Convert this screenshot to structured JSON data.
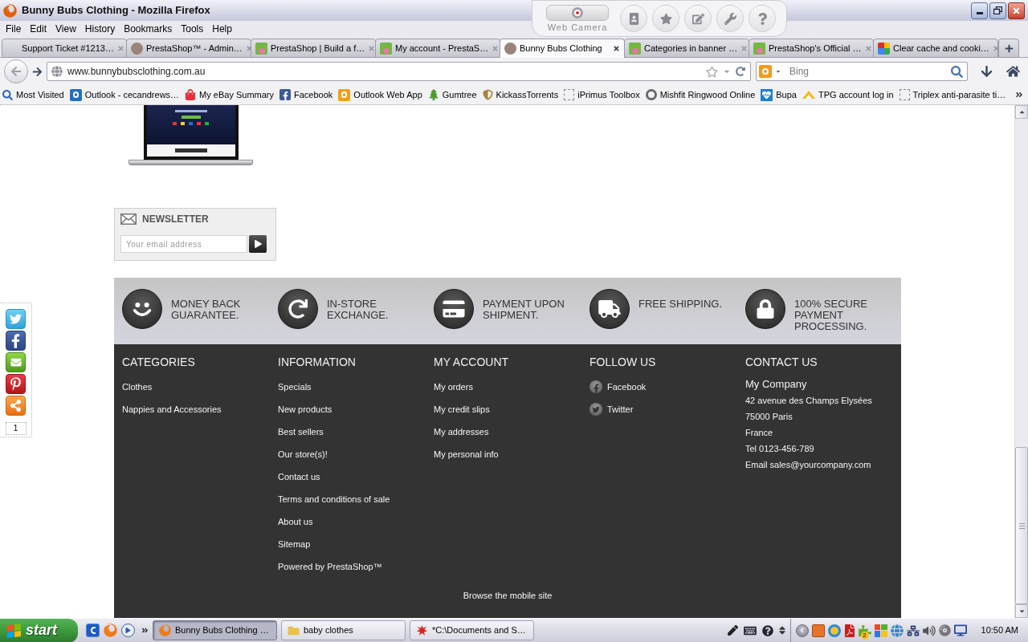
{
  "window": {
    "title": "Bunny Bubs Clothing - Mozilla Firefox"
  },
  "camera_toolbar": {
    "label": "Web Camera"
  },
  "menu": [
    "File",
    "Edit",
    "View",
    "History",
    "Bookmarks",
    "Tools",
    "Help"
  ],
  "tabs": [
    {
      "label": "Support Ticket #1213…",
      "selected": false
    },
    {
      "label": "PrestaShop™ - Admin…",
      "selected": false
    },
    {
      "label": "PrestaShop | Build a f…",
      "selected": false
    },
    {
      "label": "My account - PrestaS…",
      "selected": false
    },
    {
      "label": "Bunny Bubs Clothing",
      "selected": true
    },
    {
      "label": "Categories in banner …",
      "selected": false
    },
    {
      "label": "PrestaShop's Official …",
      "selected": false
    },
    {
      "label": "Clear cache and cooki…",
      "selected": false
    }
  ],
  "address_bar": {
    "value": "www.bunnybubsclothing.com.au"
  },
  "search": {
    "placeholder": "Bing"
  },
  "bookmarks": [
    "Most Visited",
    "Outlook - cecandrews…",
    "My eBay Summary",
    "Facebook",
    "Outlook Web App",
    "Gumtree",
    "KickassTorrents",
    "iPrimus Toolbox",
    "Mishfit Ringwood Online",
    "Bupa",
    "TPG account log in",
    "Triplex anti-parasite ti…"
  ],
  "share_sidebar": {
    "count": "1"
  },
  "newsletter": {
    "title": "NEWSLETTER",
    "placeholder": "Your email address"
  },
  "reassurance": [
    "MONEY BACK GUARANTEE.",
    "IN-STORE EXCHANGE.",
    "PAYMENT UPON SHIPMENT.",
    "FREE SHIPPING.",
    "100% SECURE PAYMENT PROCESSING."
  ],
  "footer": {
    "categories": {
      "title": "CATEGORIES",
      "links": [
        "Clothes",
        "Nappies and Accessories"
      ]
    },
    "information": {
      "title": "INFORMATION",
      "links": [
        "Specials",
        "New products",
        "Best sellers",
        "Our store(s)!",
        "Contact us",
        "Terms and conditions of sale",
        "About us",
        "Sitemap",
        "Powered by PrestaShop™"
      ]
    },
    "my_account": {
      "title": "MY ACCOUNT",
      "links": [
        "My orders",
        "My credit slips",
        "My addresses",
        "My personal info"
      ]
    },
    "follow_us": {
      "title": "FOLLOW US",
      "links": [
        "Facebook",
        "Twitter"
      ]
    },
    "contact_us": {
      "title": "CONTACT US",
      "company": "My Company",
      "lines": [
        "42 avenue des Champs Elysées",
        "75000 Paris",
        "France",
        "Tel 0123-456-789",
        "Email sales@yourcompany.com"
      ]
    },
    "mobile_link": "Browse the mobile site"
  },
  "taskbar": {
    "start": "start",
    "tasks": [
      {
        "label": "Bunny Bubs Clothing …",
        "selected": true
      },
      {
        "label": "baby clothes",
        "selected": false
      },
      {
        "label": "*C:\\Documents and S…",
        "selected": false
      }
    ],
    "tray_badge": "2",
    "clock": "10:50 AM"
  }
}
